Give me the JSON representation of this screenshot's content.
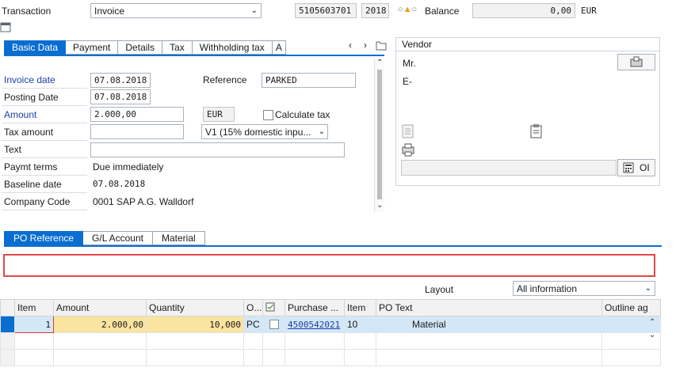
{
  "header": {
    "transaction_label": "Transaction",
    "transaction_value": "Invoice",
    "doc_number": "5105603701",
    "year": "2018",
    "balance_label": "Balance",
    "balance_value": "0,00",
    "currency": "EUR"
  },
  "top_tabs": [
    "Basic Data",
    "Payment",
    "Details",
    "Tax",
    "Withholding tax",
    "A"
  ],
  "basic_data": {
    "invoice_date_label": "Invoice date",
    "invoice_date": "07.08.2018",
    "reference_label": "Reference",
    "reference": "PARKED",
    "posting_date_label": "Posting Date",
    "posting_date": "07.08.2018",
    "amount_label": "Amount",
    "amount": "2.000,00",
    "amount_currency": "EUR",
    "calculate_tax_label": "Calculate tax",
    "tax_amount_label": "Tax amount",
    "tax_code": "V1 (15% domestic inpu...",
    "text_label": "Text",
    "paymt_terms_label": "Paymt terms",
    "paymt_terms": "Due immediately",
    "baseline_date_label": "Baseline date",
    "baseline_date": "07.08.2018",
    "company_code_label": "Company Code",
    "company_code": "0001 SAP A.G. Walldorf"
  },
  "vendor": {
    "title": "Vendor",
    "line1": "Mr.",
    "line2": "E-",
    "oi_label": "OI"
  },
  "bottom_tabs": [
    "PO Reference",
    "G/L Account",
    "Material"
  ],
  "layout": {
    "label": "Layout",
    "value": "All information"
  },
  "grid": {
    "columns": [
      "Item",
      "Amount",
      "Quantity",
      "O...",
      "",
      "Purchase ...",
      "Item",
      "PO Text",
      "Outline ag"
    ],
    "rows": [
      {
        "item": "1",
        "amount": "2.000,00",
        "quantity": "10,000",
        "unit": "PC",
        "po": "4500542021",
        "po_item": "10",
        "po_text": "Material"
      }
    ]
  },
  "colors": {
    "accent": "#0a6ed1",
    "highlight": "#fbe3a0",
    "selected_row": "#d3e7f7",
    "red_box": "#e0484a"
  }
}
